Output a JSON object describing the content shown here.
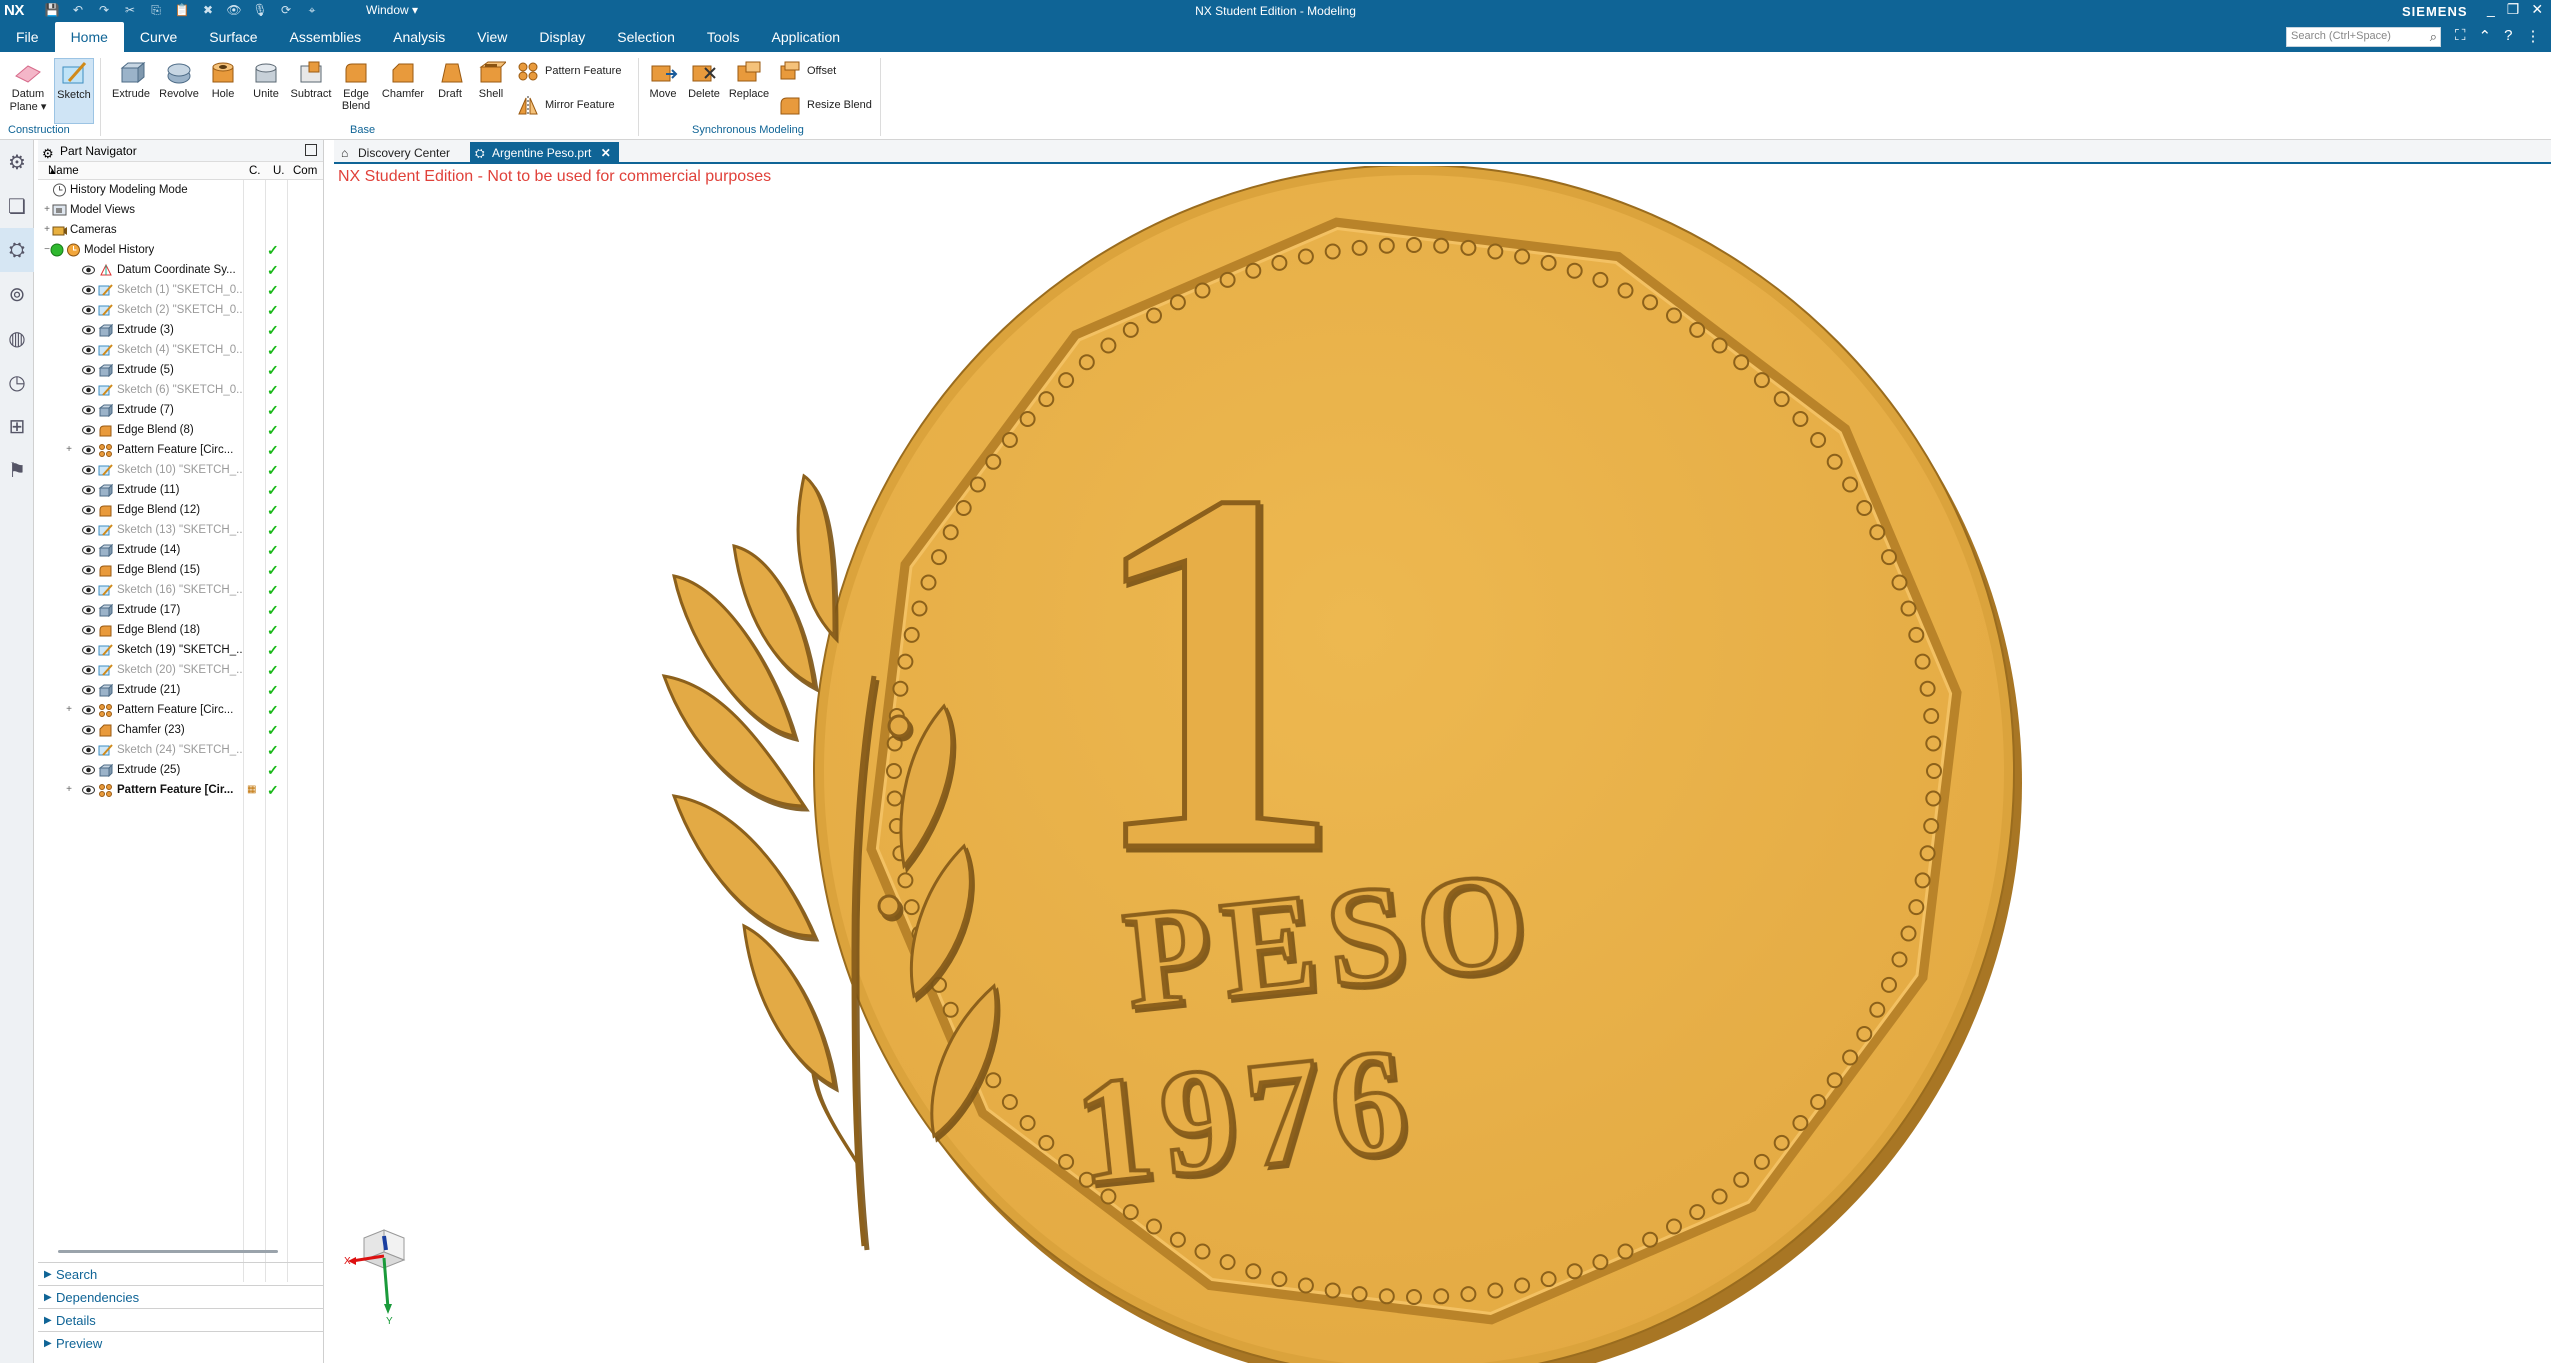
{
  "titlebar": {
    "logo": "NX",
    "window_menu": "Window ▾",
    "app_title": "NX Student Edition - Modeling",
    "brand": "SIEMENS",
    "minimize": "_",
    "restore": "❐",
    "close": "✕"
  },
  "menubar": {
    "tabs": [
      "File",
      "Home",
      "Curve",
      "Surface",
      "Assemblies",
      "Analysis",
      "View",
      "Display",
      "Selection",
      "Tools",
      "Application"
    ],
    "active_tab": "Home",
    "search_placeholder": "Search (Ctrl+Space)"
  },
  "ribbon": {
    "datum_plane": "Datum Plane ▾",
    "sketch": "Sketch",
    "construction": "Construction",
    "extrude": "Extrude",
    "revolve": "Revolve",
    "hole": "Hole",
    "unite": "Unite",
    "subtract": "Subtract",
    "edge_blend": "Edge Blend",
    "chamfer": "Chamfer",
    "draft": "Draft",
    "shell": "Shell",
    "pattern_feature": "Pattern Feature",
    "mirror_feature": "Mirror Feature",
    "base": "Base",
    "move": "Move",
    "delete": "Delete",
    "replace": "Replace",
    "offset": "Offset",
    "resize_blend": "Resize Blend",
    "synchronous_modeling": "Synchronous Modeling"
  },
  "navigator": {
    "title": "Part Navigator",
    "col_name": "Name",
    "col_c": "C.",
    "col_u": "U.",
    "col_com": "Com",
    "rows": [
      {
        "label": "History Modeling Mode",
        "indent": 0,
        "expander": "",
        "style": "normal",
        "check": false,
        "icon": "clock"
      },
      {
        "label": "Model Views",
        "indent": 0,
        "expander": "+",
        "style": "normal",
        "check": false,
        "icon": "views"
      },
      {
        "label": "Cameras",
        "indent": 0,
        "expander": "+",
        "style": "normal",
        "check": false,
        "icon": "camera"
      },
      {
        "label": "Model History",
        "indent": 0,
        "expander": "−",
        "style": "normal",
        "check": true,
        "icon": "history"
      },
      {
        "label": "Datum Coordinate Sy...",
        "indent": 1,
        "expander": "",
        "style": "normal",
        "check": true,
        "icon": "datum"
      },
      {
        "label": "Sketch (1) \"SKETCH_0...",
        "indent": 1,
        "expander": "",
        "style": "gray",
        "check": true,
        "icon": "sketch"
      },
      {
        "label": "Sketch (2) \"SKETCH_0...",
        "indent": 1,
        "expander": "",
        "style": "gray",
        "check": true,
        "icon": "sketch"
      },
      {
        "label": "Extrude (3)",
        "indent": 1,
        "expander": "",
        "style": "normal",
        "check": true,
        "icon": "extrude"
      },
      {
        "label": "Sketch (4) \"SKETCH_0...",
        "indent": 1,
        "expander": "",
        "style": "gray",
        "check": true,
        "icon": "sketch"
      },
      {
        "label": "Extrude (5)",
        "indent": 1,
        "expander": "",
        "style": "normal",
        "check": true,
        "icon": "extrude"
      },
      {
        "label": "Sketch (6) \"SKETCH_0...",
        "indent": 1,
        "expander": "",
        "style": "gray",
        "check": true,
        "icon": "sketch"
      },
      {
        "label": "Extrude (7)",
        "indent": 1,
        "expander": "",
        "style": "normal",
        "check": true,
        "icon": "extrude"
      },
      {
        "label": "Edge Blend (8)",
        "indent": 1,
        "expander": "",
        "style": "normal",
        "check": true,
        "icon": "blend"
      },
      {
        "label": "Pattern Feature [Circ...",
        "indent": 1,
        "expander": "+",
        "style": "normal",
        "check": true,
        "icon": "pattern"
      },
      {
        "label": "Sketch (10) \"SKETCH_...",
        "indent": 1,
        "expander": "",
        "style": "gray",
        "check": true,
        "icon": "sketch"
      },
      {
        "label": "Extrude (11)",
        "indent": 1,
        "expander": "",
        "style": "normal",
        "check": true,
        "icon": "extrude"
      },
      {
        "label": "Edge Blend (12)",
        "indent": 1,
        "expander": "",
        "style": "normal",
        "check": true,
        "icon": "blend"
      },
      {
        "label": "Sketch (13) \"SKETCH_...",
        "indent": 1,
        "expander": "",
        "style": "gray",
        "check": true,
        "icon": "sketch"
      },
      {
        "label": "Extrude (14)",
        "indent": 1,
        "expander": "",
        "style": "normal",
        "check": true,
        "icon": "extrude"
      },
      {
        "label": "Edge Blend (15)",
        "indent": 1,
        "expander": "",
        "style": "normal",
        "check": true,
        "icon": "blend"
      },
      {
        "label": "Sketch (16) \"SKETCH_...",
        "indent": 1,
        "expander": "",
        "style": "gray",
        "check": true,
        "icon": "sketch"
      },
      {
        "label": "Extrude (17)",
        "indent": 1,
        "expander": "",
        "style": "normal",
        "check": true,
        "icon": "extrude"
      },
      {
        "label": "Edge Blend (18)",
        "indent": 1,
        "expander": "",
        "style": "normal",
        "check": true,
        "icon": "blend"
      },
      {
        "label": "Sketch (19) \"SKETCH_...",
        "indent": 1,
        "expander": "",
        "style": "normal",
        "check": true,
        "icon": "sketch"
      },
      {
        "label": "Sketch (20) \"SKETCH_...",
        "indent": 1,
        "expander": "",
        "style": "gray",
        "check": true,
        "icon": "sketch"
      },
      {
        "label": "Extrude (21)",
        "indent": 1,
        "expander": "",
        "style": "normal",
        "check": true,
        "icon": "extrude"
      },
      {
        "label": "Pattern Feature [Circ...",
        "indent": 1,
        "expander": "+",
        "style": "normal",
        "check": true,
        "icon": "pattern"
      },
      {
        "label": "Chamfer (23)",
        "indent": 1,
        "expander": "",
        "style": "normal",
        "check": true,
        "icon": "chamfer"
      },
      {
        "label": "Sketch (24) \"SKETCH_...",
        "indent": 1,
        "expander": "",
        "style": "gray",
        "check": true,
        "icon": "sketch"
      },
      {
        "label": "Extrude (25)",
        "indent": 1,
        "expander": "",
        "style": "normal",
        "check": true,
        "icon": "extrude"
      },
      {
        "label": "Pattern Feature [Cir...",
        "indent": 1,
        "expander": "+",
        "style": "bold",
        "check": true,
        "icon": "pattern"
      }
    ],
    "panes": [
      "Search",
      "Dependencies",
      "Details",
      "Preview"
    ]
  },
  "document_tabs": {
    "discovery": "Discovery Center",
    "part": "Argentine Peso.prt",
    "close": "✕"
  },
  "graphics": {
    "watermark": "NX Student Edition - Not to be used for commercial purposes",
    "coin_value": "1",
    "coin_word": "PESO",
    "coin_year": "1976",
    "axis_x": "X",
    "axis_y": "Y"
  },
  "colors": {
    "brand_blue": "#0f6496",
    "coin_face": "#e9b24a",
    "coin_edge": "#b07d28",
    "coin_relief": "#d9a23c",
    "check_green": "#18b818",
    "watermark_red": "#e0413a"
  }
}
